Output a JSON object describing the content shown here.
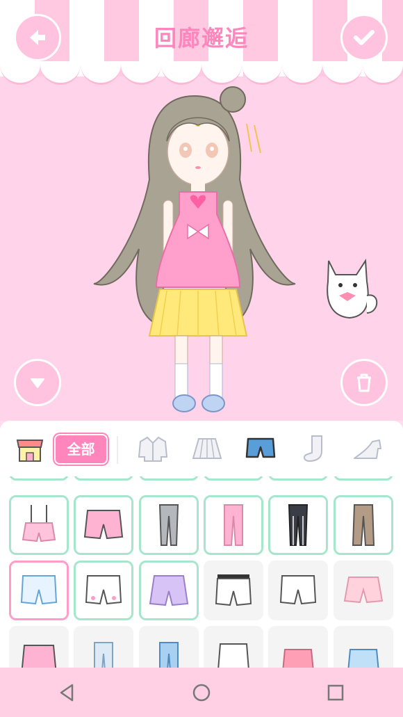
{
  "header": {
    "title": "回廊邂逅"
  },
  "toolbar": {
    "all_label": "全部"
  },
  "categories": [
    "shop",
    "all",
    "jacket",
    "skirt",
    "shorts",
    "socks",
    "shoes"
  ],
  "active_category": "shorts",
  "colors": {
    "accent_pink": "#ff86bd",
    "owned_border": "#a6e6cd",
    "selected_border": "#ff9cc7",
    "navbar": "#ffcfe4"
  },
  "items": [
    {
      "row": 0,
      "col": 0,
      "type": "overall-shorts",
      "owned": true
    },
    {
      "row": 0,
      "col": 1,
      "type": "pink-shorts",
      "owned": true
    },
    {
      "row": 0,
      "col": 2,
      "type": "gray-pants",
      "owned": true
    },
    {
      "row": 0,
      "col": 3,
      "type": "pink-pants",
      "owned": true
    },
    {
      "row": 0,
      "col": 4,
      "type": "black-pants",
      "owned": true
    },
    {
      "row": 0,
      "col": 5,
      "type": "brown-pants",
      "owned": true
    },
    {
      "row": 1,
      "col": 0,
      "type": "denim-shorts",
      "owned": true,
      "selected": true
    },
    {
      "row": 1,
      "col": 1,
      "type": "white-bow-shorts",
      "owned": true
    },
    {
      "row": 1,
      "col": 2,
      "type": "lavender-ruffle-shorts",
      "owned": true
    },
    {
      "row": 1,
      "col": 3,
      "type": "white-belt-shorts",
      "owned": false
    },
    {
      "row": 1,
      "col": 4,
      "type": "white-shorts",
      "owned": false
    },
    {
      "row": 1,
      "col": 5,
      "type": "peach-ruffle-shorts",
      "owned": false
    }
  ],
  "navbar": {
    "icons": [
      "back-triangle-icon",
      "home-circle-icon",
      "recents-square-icon"
    ]
  }
}
